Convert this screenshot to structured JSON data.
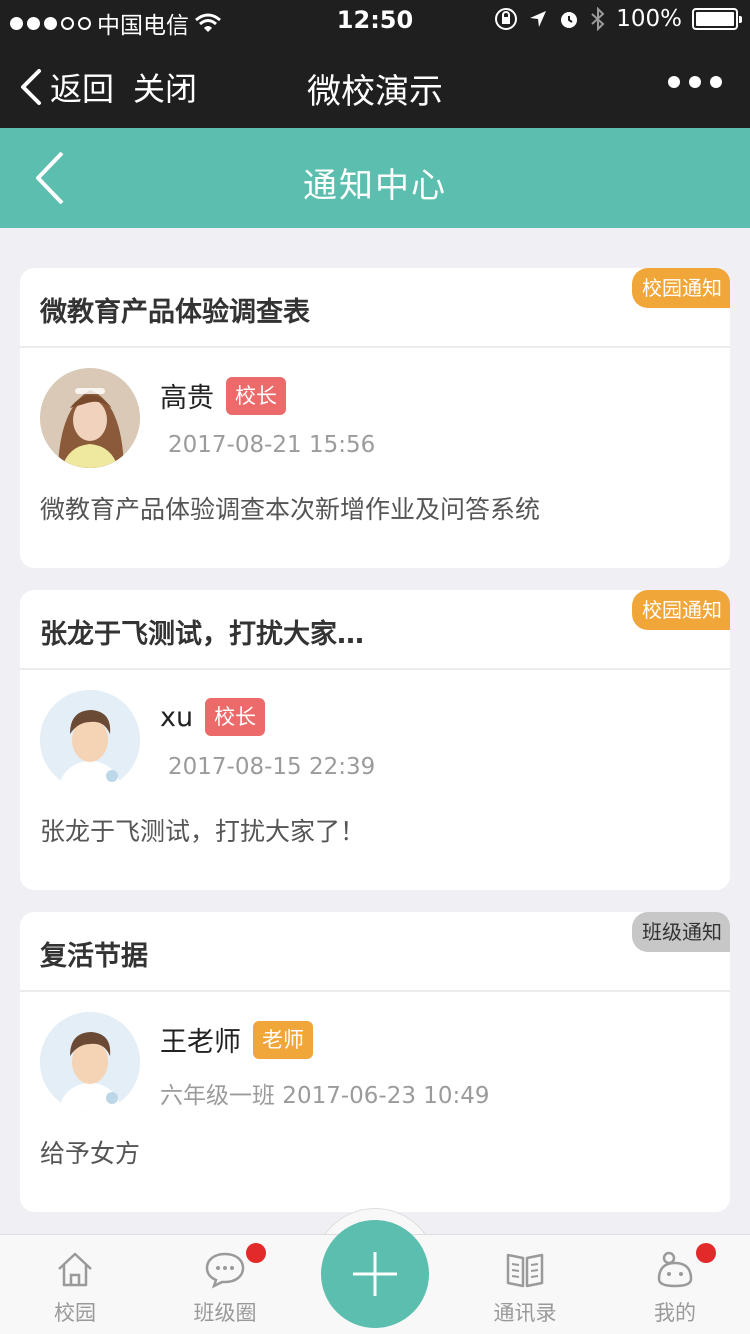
{
  "status_bar": {
    "carrier": "中国电信",
    "time": "12:50",
    "battery": "100%"
  },
  "wechat_nav": {
    "back_label": "返回",
    "close_label": "关闭",
    "title": "微校演示"
  },
  "header": {
    "title": "通知中心"
  },
  "notices": [
    {
      "title": "微教育产品体验调查表",
      "tag": "校园通知",
      "tag_color": "#f1a63a",
      "author": "高贵",
      "role": "校长",
      "role_color": "#ec6a6a",
      "meta": "2017-08-21 15:56",
      "content": "微教育产品体验调查本次新增作业及问答系统"
    },
    {
      "title": "张龙于飞测试，打扰大家…",
      "tag": "校园通知",
      "tag_color": "#f1a63a",
      "author": "xu",
      "role": "校长",
      "role_color": "#ec6a6a",
      "meta": "2017-08-15 22:39",
      "content": "张龙于飞测试，打扰大家了！"
    },
    {
      "title": "复活节据",
      "tag": "班级通知",
      "tag_color": "#c7c7c7",
      "author": "王老师",
      "role": "老师",
      "role_color": "#f1a63a",
      "meta": "六年级一班 2017-06-23 10:49",
      "content": "给予女方"
    }
  ],
  "tabbar": {
    "items": [
      {
        "label": "校园",
        "icon": "house-icon"
      },
      {
        "label": "班级圈",
        "icon": "chat-bubble-icon",
        "badge": true
      },
      {
        "label": "",
        "icon": "plus-icon"
      },
      {
        "label": "通讯录",
        "icon": "book-icon"
      },
      {
        "label": "我的",
        "icon": "profile-icon",
        "badge": true
      }
    ]
  },
  "colors": {
    "accent": "#5bbeae",
    "badge": "#e22a2a"
  }
}
